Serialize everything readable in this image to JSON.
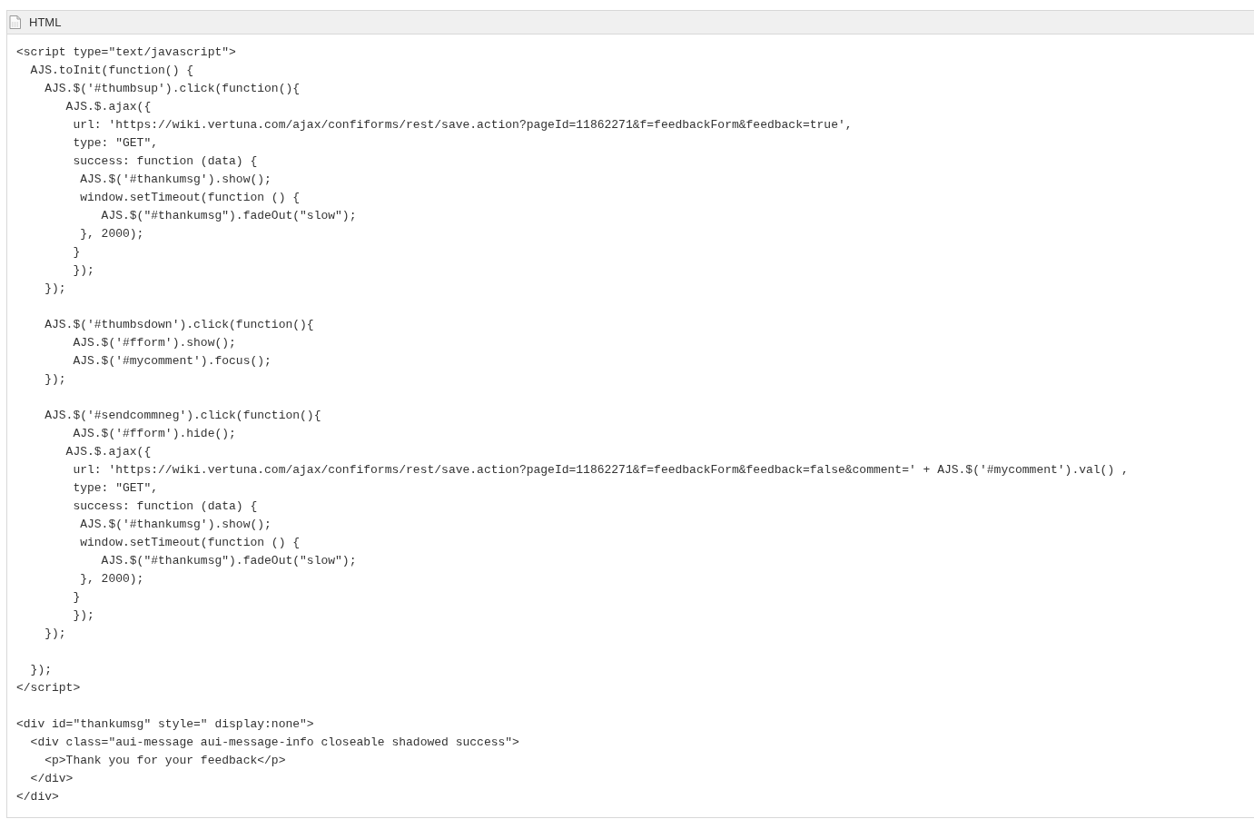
{
  "panel": {
    "title": "HTML"
  },
  "code_blocks": [
    [
      "<script type=\"text/javascript\">",
      "  AJS.toInit(function() {",
      "    AJS.$('#thumbsup').click(function(){",
      "       AJS.$.ajax({",
      "        url: 'https://wiki.vertuna.com/ajax/confiforms/rest/save.action?pageId=11862271&f=feedbackForm&feedback=true',",
      "        type: \"GET\",",
      "        success: function (data) {",
      "         AJS.$('#thankumsg').show();",
      "         window.setTimeout(function () {",
      "            AJS.$(\"#thankumsg\").fadeOut(\"slow\");",
      "         }, 2000);",
      "        }",
      "        });",
      "    });"
    ],
    [
      "    AJS.$('#thumbsdown').click(function(){",
      "        AJS.$('#fform').show();",
      "        AJS.$('#mycomment').focus();",
      "    });"
    ],
    [
      "    AJS.$('#sendcommneg').click(function(){",
      "        AJS.$('#fform').hide();",
      "       AJS.$.ajax({",
      "        url: 'https://wiki.vertuna.com/ajax/confiforms/rest/save.action?pageId=11862271&f=feedbackForm&feedback=false&comment=' + AJS.$('#mycomment').val() ,",
      "        type: \"GET\",",
      "        success: function (data) {",
      "         AJS.$('#thankumsg').show();",
      "         window.setTimeout(function () {",
      "            AJS.$(\"#thankumsg\").fadeOut(\"slow\");",
      "         }, 2000);",
      "        }",
      "        });",
      "    });"
    ],
    [
      "  });",
      "</script>"
    ],
    [
      "<div id=\"thankumsg\" style=\" display:none\">",
      "  <div class=\"aui-message aui-message-info closeable shadowed success\">",
      "    <p>Thank you for your feedback</p>",
      "  </div>",
      "</div>"
    ]
  ]
}
